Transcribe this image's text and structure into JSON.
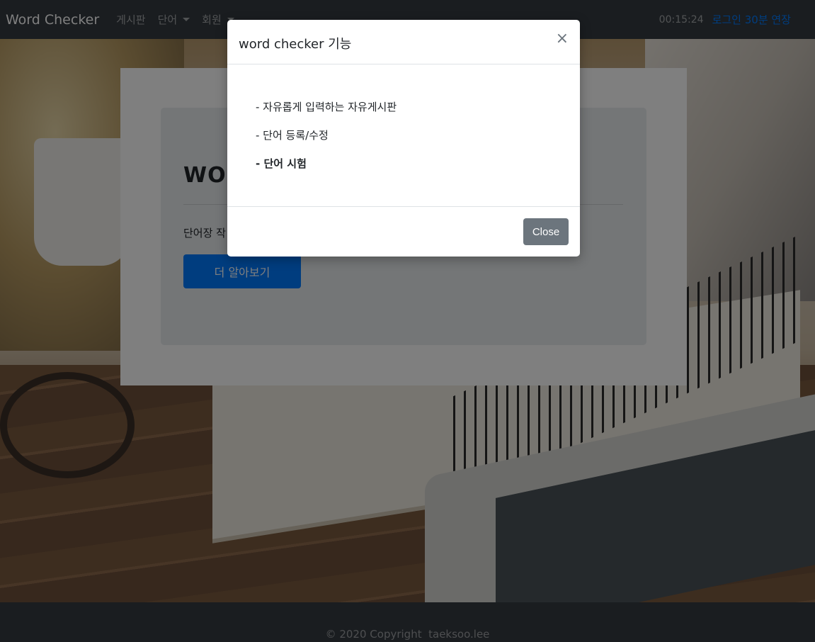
{
  "navbar": {
    "brand": "Word Checker",
    "items": [
      {
        "label": "게시판"
      },
      {
        "label": "단어"
      },
      {
        "label": "회원"
      }
    ],
    "timer": "00:15:24",
    "extend_link": "로그인 30분 연장"
  },
  "jumbotron": {
    "title": "WOR",
    "lead": "단어장 작",
    "button": "더 알아보기"
  },
  "modal": {
    "title": "word checker 기능",
    "close_icon": "×",
    "features": [
      "- 자유롭게 입력하는 자유게시판",
      "- 단어 등록/수정",
      "- 단어 시험"
    ],
    "close_button": "Close"
  },
  "footer": {
    "text": "© 2020 Copyright  taeksoo.lee"
  },
  "colors": {
    "navbar_bg": "#343a40",
    "primary": "#007bff",
    "secondary": "#6c757d"
  }
}
